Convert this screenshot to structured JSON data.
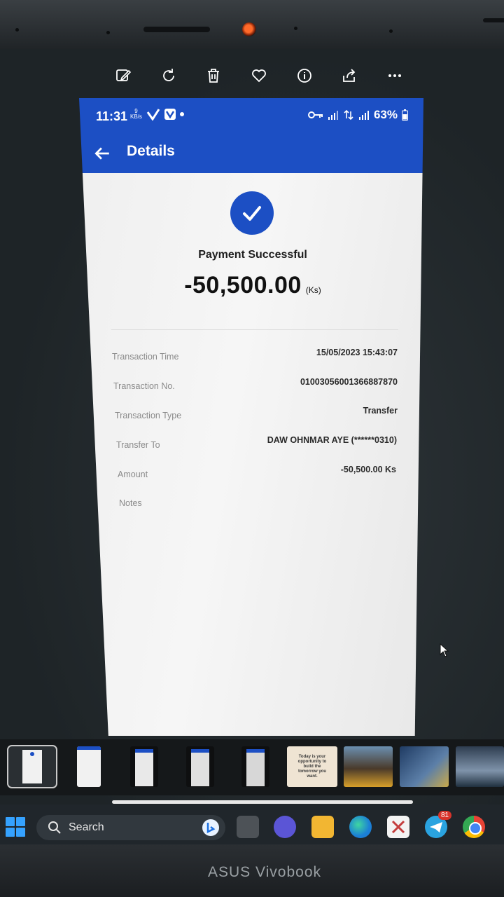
{
  "photo_toolbar": {
    "icons": [
      "edit-icon",
      "rotate-icon",
      "delete-icon",
      "favorite-icon",
      "info-icon",
      "share-icon",
      "more-icon"
    ]
  },
  "phone": {
    "status_bar": {
      "time": "11:31",
      "net_speed_top": "9",
      "net_speed_unit": "KB/s",
      "battery_percent": "63%"
    },
    "app_bar": {
      "title": "Details"
    },
    "payment": {
      "status": "Payment Successful",
      "amount": "-50,500.00",
      "currency": "(Ks)"
    },
    "details": [
      {
        "label": "Transaction Time",
        "value": "15/05/2023 15:43:07"
      },
      {
        "label": "Transaction No.",
        "value": "01003056001366887870"
      },
      {
        "label": "Transaction Type",
        "value": "Transfer"
      },
      {
        "label": "Transfer To",
        "value": "DAW OHNMAR AYE (******0310)"
      },
      {
        "label": "Amount",
        "value": "-50,500.00 Ks"
      },
      {
        "label": "Notes",
        "value": ""
      }
    ],
    "colors": {
      "primary": "#1c4fc4"
    }
  },
  "thumbnails": [
    {
      "kind": "receipt"
    },
    {
      "kind": "receipt"
    },
    {
      "kind": "dark-receipt"
    },
    {
      "kind": "dark-receipt"
    },
    {
      "kind": "dark-receipt"
    },
    {
      "kind": "quote",
      "text": "Today is your opportunity to build the tomorrow you want."
    },
    {
      "kind": "photo"
    },
    {
      "kind": "photo"
    },
    {
      "kind": "photo"
    }
  ],
  "taskbar": {
    "search_placeholder": "Search",
    "telegram_badge": "81"
  },
  "laptop": {
    "brand": "ASUS Vivobook"
  }
}
